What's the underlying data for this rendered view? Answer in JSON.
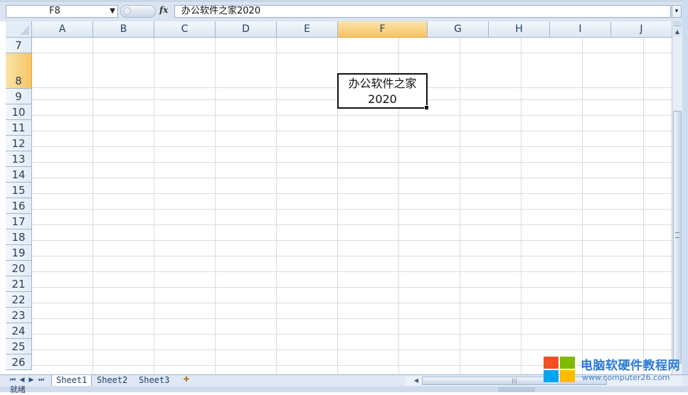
{
  "formula_bar": {
    "name_box": "F8",
    "fx_label": "fx",
    "formula": "办公软件之家2020"
  },
  "columns": [
    "A",
    "B",
    "C",
    "D",
    "E",
    "F",
    "G",
    "H",
    "I",
    "J"
  ],
  "selected_column": "F",
  "rows": [
    "7",
    "8",
    "9",
    "10",
    "11",
    "12",
    "13",
    "14",
    "15",
    "16",
    "17",
    "18",
    "19",
    "20",
    "21",
    "22",
    "23",
    "24",
    "25",
    "26"
  ],
  "selected_row": "8",
  "active_cell": {
    "ref": "F8",
    "line1": "办公软件之家",
    "line2": "2020"
  },
  "sheet_tabs": [
    "Sheet1",
    "Sheet2",
    "Sheet3"
  ],
  "active_sheet": "Sheet1",
  "status": {
    "ready_label": "就绪"
  },
  "watermark": {
    "title": "电脑软硬件教程网",
    "url": "www.computer26.com",
    "colors": {
      "red": "#f25022",
      "green": "#7fba00",
      "blue": "#00a4ef",
      "yellow": "#ffb900"
    }
  },
  "colors": {
    "header_selected": "#f7c564",
    "grid_line": "#dadcdd",
    "header_bg": "#dde7f3"
  }
}
